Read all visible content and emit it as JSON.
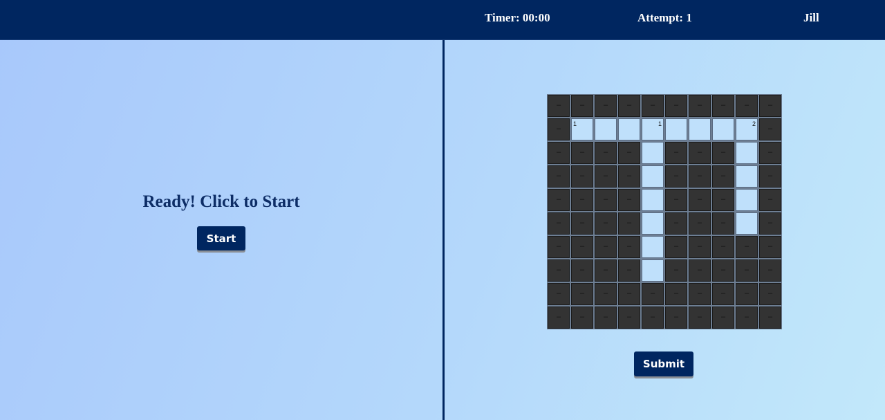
{
  "header": {
    "timer": "Timer: 00:00",
    "attempt": "Attempt: 1",
    "user": "Jill"
  },
  "left_panel": {
    "status": "Ready! Click to Start",
    "start_label": "Start"
  },
  "right_panel": {
    "submit_label": "Submit"
  },
  "puzzle": {
    "rows": 10,
    "cols": 10,
    "black_symbol": "–",
    "layout": [
      "##########",
      "#........#",
      "####.###.#",
      "####.###.#",
      "####.###.#",
      "####.###.#",
      "####.#####",
      "####.#####",
      "##########",
      "##########"
    ],
    "clues": [
      {
        "row": 1,
        "col": 1,
        "number": "1",
        "align": "left"
      },
      {
        "row": 1,
        "col": 4,
        "number": "1",
        "align": "right"
      },
      {
        "row": 1,
        "col": 8,
        "number": "2",
        "align": "right"
      }
    ]
  },
  "colors": {
    "header": "#002660",
    "black_cell": "#333333",
    "white_cell": "#bfe0fb",
    "accent_text": "#0d2d66"
  }
}
